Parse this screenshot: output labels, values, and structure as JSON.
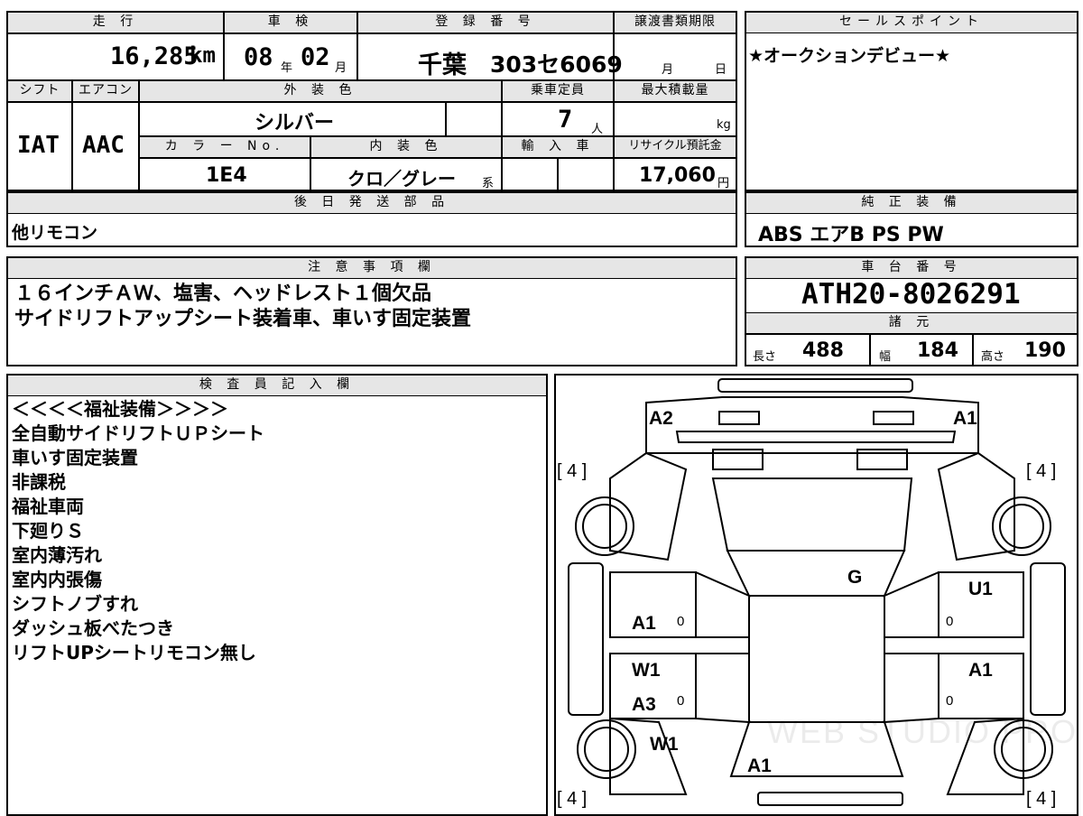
{
  "top": {
    "labels": {
      "mileage": "走 行",
      "inspection": "車 検",
      "registration": "登 録 番 号",
      "transfer_deadline": "譲渡書類期限",
      "sales_point": "セールスポイント"
    },
    "mileage_value": "16,285",
    "mileage_unit": "km",
    "inspection_year": "08",
    "year_suffix": "年",
    "inspection_month": "02",
    "month_suffix": "月",
    "reg_region": "千葉",
    "reg_number": "303セ6069",
    "deadline_month": "月",
    "deadline_day": "日",
    "sales_point_text": "★オークションデビュー★"
  },
  "spec": {
    "labels": {
      "shift": "シフト",
      "aircon": "エアコン",
      "exterior_color": "外 装 色",
      "capacity": "乗車定員",
      "max_load": "最大積載量",
      "color_no": "カ ラ ー No.",
      "interior_color": "内 装 色",
      "import": "輸 入 車",
      "recycle": "リサイクル預託金"
    },
    "shift_value": "IAT",
    "aircon_value": "AAC",
    "exterior_value": "シルバー",
    "capacity_value": "7",
    "capacity_unit": "人",
    "max_load_unit": "kg",
    "color_no_value": "1E4",
    "interior_value": "クロ／グレー",
    "interior_suffix": "系",
    "recycle_value": "17,060",
    "recycle_unit": "円"
  },
  "parts": {
    "label": "後 日 発 送 部 品",
    "value": "他リモコン"
  },
  "equipment": {
    "label": "純 正 装 備",
    "value": "ABS エアB PS PW"
  },
  "notes": {
    "label": "注 意 事 項 欄",
    "lines": [
      "１６インチＡＷ、塩害、ヘッドレスト１個欠品",
      "サイドリフトアップシート装着車、車いす固定装置"
    ]
  },
  "chassis": {
    "label": "車 台 番 号",
    "value": "ATH20-8026291",
    "spec_label": "諸 元",
    "length_label": "長さ",
    "length_value": "488",
    "width_label": "幅",
    "width_value": "184",
    "height_label": "高さ",
    "height_value": "190"
  },
  "inspector": {
    "label": "検 査 員 記 入 欄",
    "lines": [
      "＜＜＜＜福祉装備＞＞＞＞",
      "全自動サイドリフトＵＰシート",
      "車いす固定装置",
      "非課税",
      "福祉車両",
      "下廻りＳ",
      "室内薄汚れ",
      "室内内張傷",
      "シフトノブすれ",
      "ダッシュ板べたつき",
      "リフトUPシートリモコン無し"
    ]
  },
  "diagram": {
    "tire_tl": "[ 4 ]",
    "tire_tr": "[ 4 ]",
    "tire_bl": "[ 4 ]",
    "tire_br": "[ 4 ]",
    "a2": "A2",
    "a1_top": "A1",
    "g": "G",
    "u1": "U1",
    "a1_left": "A1",
    "w1_left": "W1",
    "a1_right": "A1",
    "a3": "A3",
    "w1_rear": "W1",
    "a1_rear": "A1",
    "zero": "0",
    "watermark": "WEB STUDIO PRO"
  }
}
